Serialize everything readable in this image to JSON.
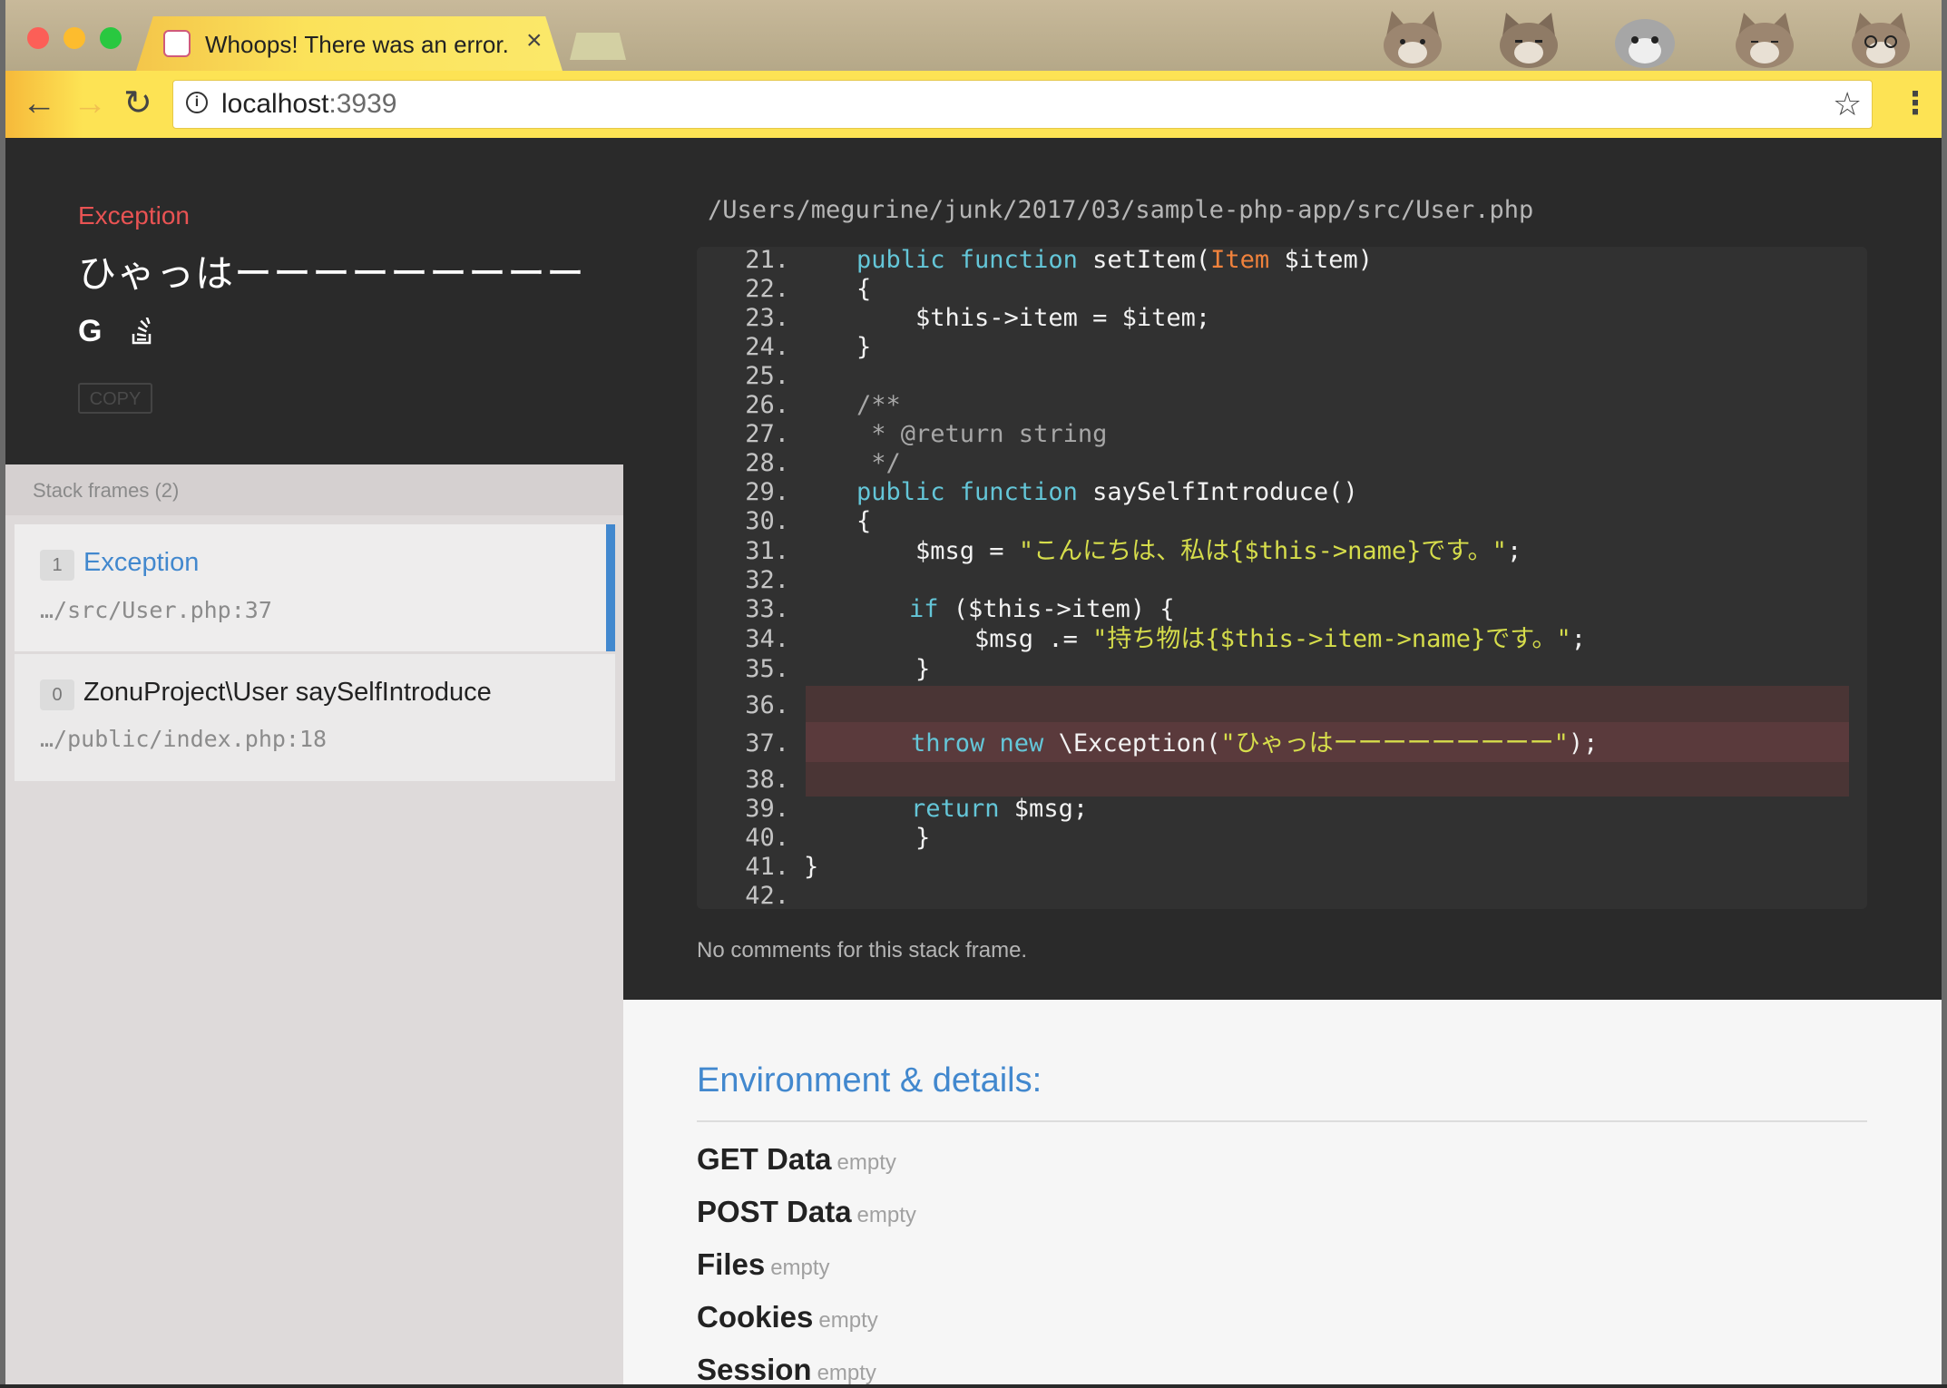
{
  "browser": {
    "tab_title": "Whoops! There was an error.",
    "tab_close": "×",
    "url_host": "localhost",
    "url_port": ":3939",
    "back": "←",
    "forward": "→",
    "reload": "↻",
    "star": "☆",
    "menu": "⋮"
  },
  "exception": {
    "class": "Exception",
    "message": "ひゃっはーーーーーーーーー",
    "google_label": "G",
    "copy_label": "COPY"
  },
  "stack": {
    "title": "Stack frames (2)",
    "frames": [
      {
        "num": "1",
        "class": "Exception",
        "file": "…/src/User.php:37"
      },
      {
        "num": "0",
        "class": "ZonuProject\\User saySelfIntroduce",
        "file": "…/public/index.php:18"
      }
    ]
  },
  "code": {
    "path": "/Users/megurine/junk/2017/03/sample-php-app/src/User.php",
    "line_numbers": [
      "21.",
      "22.",
      "23.",
      "24.",
      "25.",
      "26.",
      "27.",
      "28.",
      "29.",
      "30.",
      "31.",
      "32.",
      "33.",
      "34.",
      "35.",
      "36.",
      "37.",
      "38.",
      "39.",
      "40.",
      "41.",
      "42."
    ],
    "l21_kw": "public function",
    "l21_fn": " setItem(",
    "l21_type": "Item",
    "l21_rest": " $item)",
    "l22": "{",
    "l23": "    $this->item = $item;",
    "l24": "}",
    "l26": "/**",
    "l27": " * @return string",
    "l28": " */",
    "l29_kw": "public function",
    "l29_rest": " saySelfIntroduce()",
    "l30": "{",
    "l31_a": "    $msg = ",
    "l31_str": "\"こんにちは、私は{$this->name}です。\"",
    "l31_b": ";",
    "l33_kw": "if",
    "l33_rest": " ($this->item) {",
    "l34_a": "        $msg .= ",
    "l34_str": "\"持ち物は{$this->item->name}です。\"",
    "l34_b": ";",
    "l35": "    }",
    "l37_kw": "throw new",
    "l37_a": " \\Exception(",
    "l37_str": "\"ひゃっはーーーーーーーーー\"",
    "l37_b": ");",
    "l39_kw": "return",
    "l39_rest": " $msg;",
    "l40": "    }",
    "l41": "}",
    "no_comments": "No comments for this stack frame."
  },
  "env": {
    "title": "Environment & details:",
    "rows": [
      {
        "name": "GET Data",
        "value": "empty"
      },
      {
        "name": "POST Data",
        "value": "empty"
      },
      {
        "name": "Files",
        "value": "empty"
      },
      {
        "name": "Cookies",
        "value": "empty"
      },
      {
        "name": "Session",
        "value": "empty"
      }
    ]
  },
  "colors": {
    "exception_red": "#e95353",
    "link_blue": "#4288ce",
    "keyword": "#64c6d8",
    "string": "#d6dd4b"
  }
}
